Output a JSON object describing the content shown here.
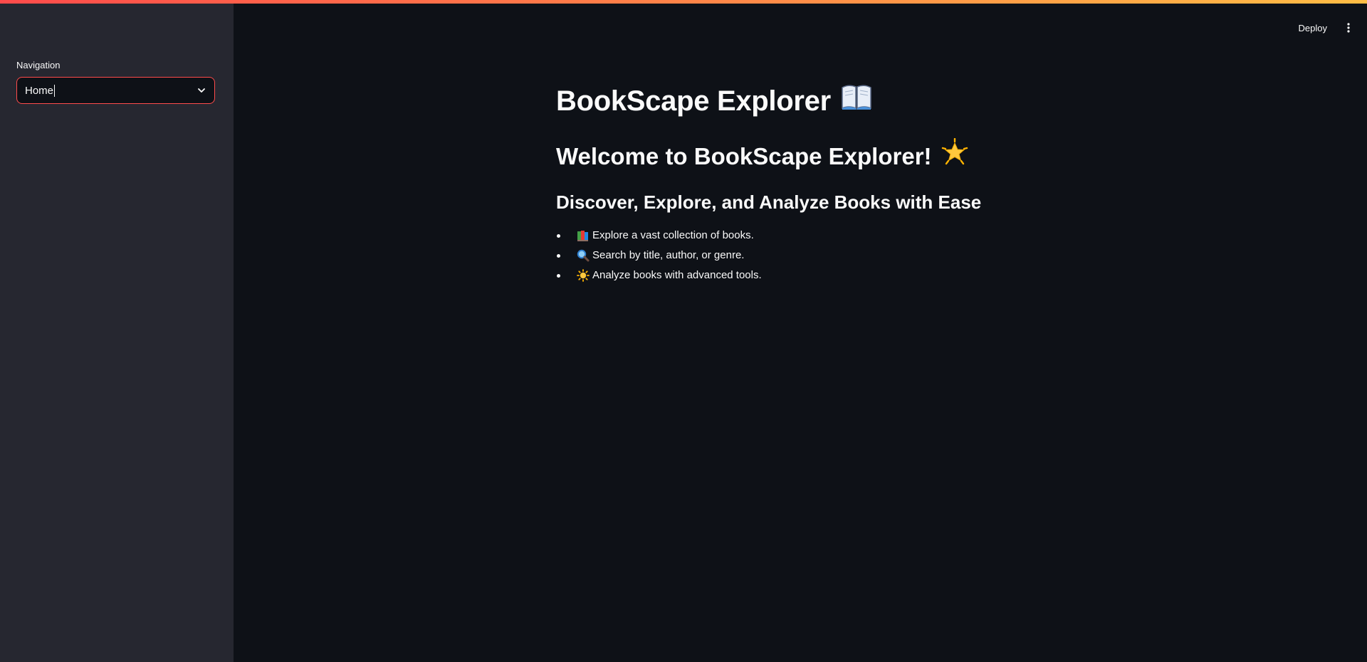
{
  "sidebar": {
    "nav_label": "Navigation",
    "select_value": "Home"
  },
  "header": {
    "deploy_label": "Deploy",
    "menu_icon": "vertical-ellipsis-icon"
  },
  "main": {
    "title": "BookScape Explorer",
    "title_icon": "open-book-icon",
    "welcome": "Welcome to BookScape Explorer!",
    "welcome_icon": "glowing-star-icon",
    "subheading": "Discover, Explore, and Analyze Books with Ease",
    "features": [
      {
        "icon": "books-icon",
        "text": "Explore a vast collection of books."
      },
      {
        "icon": "magnifier-icon",
        "text": "Search by title, author, or genre."
      },
      {
        "icon": "sun-icon",
        "text": "Analyze books with advanced tools."
      }
    ]
  },
  "colors": {
    "background": "#0e1117",
    "sidebar": "#262730",
    "accent": "#ff4b4b",
    "text": "#fafafa"
  }
}
